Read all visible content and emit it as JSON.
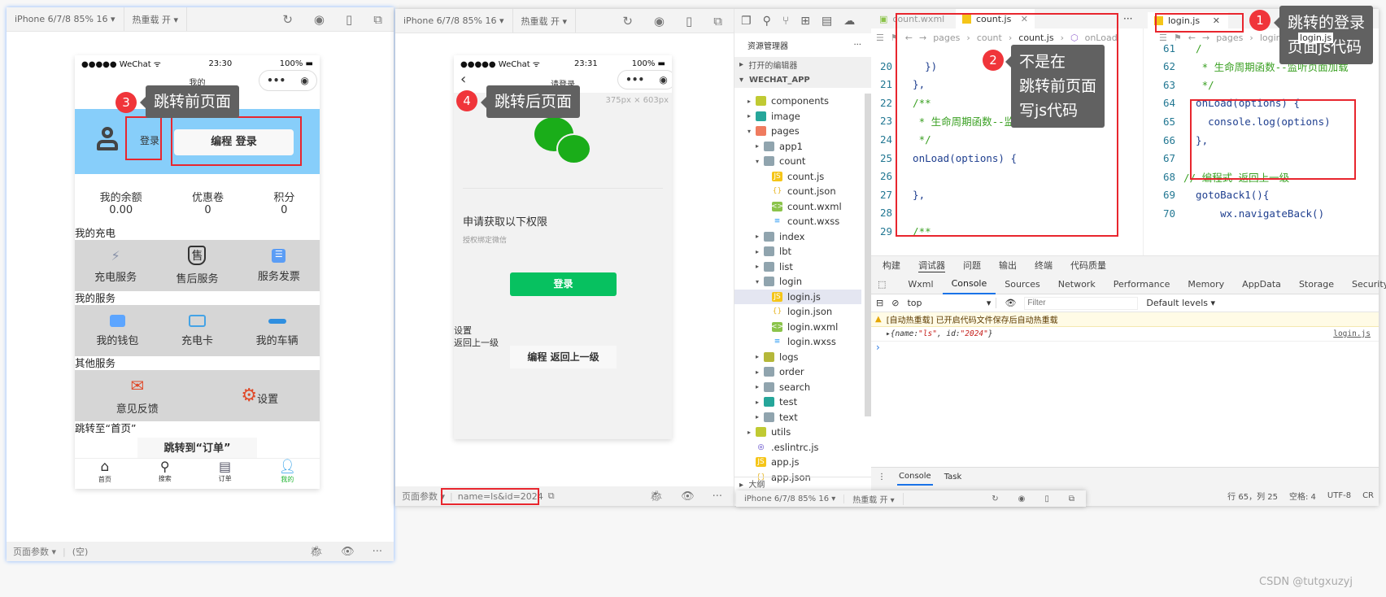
{
  "left_sim": {
    "device": "iPhone 6/7/8 85% 16 ▾",
    "hot_reload": "热重载 开 ▾",
    "status_carrier": "●●●●● WeChat ᯤ",
    "status_time": "23:30",
    "status_battery": "100%",
    "nav_title": "我的",
    "login_link": "登录",
    "login_button": "编程 登录",
    "stats": [
      {
        "label": "我的余额",
        "value": "0.00"
      },
      {
        "label": "优惠卷",
        "value": "0"
      },
      {
        "label": "积分",
        "value": "0"
      }
    ],
    "section_charge": "我的充电",
    "charge_items": [
      {
        "label": "充电服务",
        "icon": "plug-icon"
      },
      {
        "label": "售后服务",
        "icon": "shield-icon"
      },
      {
        "label": "服务发票",
        "icon": "invoice-icon"
      }
    ],
    "section_service": "我的服务",
    "service_items": [
      {
        "label": "我的钱包",
        "icon": "wallet-icon"
      },
      {
        "label": "充电卡",
        "icon": "card-icon"
      },
      {
        "label": "我的车辆",
        "icon": "car-icon"
      }
    ],
    "section_other": "其他服务",
    "other_items": [
      {
        "label": "意见反馈",
        "icon": "mail-icon"
      },
      {
        "label": "设置",
        "icon": "gear-icon"
      }
    ],
    "goto_home": "跳转至“首页”",
    "goto_order_button": "跳转到“订单”",
    "tabbar": [
      {
        "label": "首页",
        "icon": "home-icon"
      },
      {
        "label": "搜索",
        "icon": "search-icon"
      },
      {
        "label": "订单",
        "icon": "order-icon"
      },
      {
        "label": "我的",
        "icon": "user-icon",
        "active": true
      }
    ],
    "page_params_label": "页面参数 ▾",
    "page_params_value": "(空)"
  },
  "mid_sim": {
    "device": "iPhone 6/7/8 85% 16 ▾",
    "hot_reload": "热重载 开 ▾",
    "status_carrier": "●●●●● WeChat ᯤ",
    "status_time": "23:31",
    "status_battery": "100%",
    "nav_title": "请登录",
    "size_hint": "375px × 603px",
    "perm_title": "申请获取以下权限",
    "perm_desc": "授权绑定微信",
    "login_button": "登录",
    "settings_text": "设置",
    "back_text": "返回上一级",
    "back_button": "编程 返回上一级",
    "page_params_label": "页面参数 ▾",
    "page_params_value": "name=ls&id=2024"
  },
  "explorer": {
    "title": "资源管理器",
    "more": "···",
    "open_editors": "打开的编辑器",
    "root": "WECHAT_APP",
    "items": [
      {
        "label": "components",
        "depth": 1,
        "type": "folder-green",
        "tri": "▸"
      },
      {
        "label": "image",
        "depth": 1,
        "type": "folder-teal",
        "tri": "▸"
      },
      {
        "label": "pages",
        "depth": 1,
        "type": "folder-red",
        "tri": "▾"
      },
      {
        "label": "app1",
        "depth": 2,
        "type": "folder",
        "tri": "▸"
      },
      {
        "label": "count",
        "depth": 2,
        "type": "folder",
        "tri": "▾"
      },
      {
        "label": "count.js",
        "depth": 3,
        "type": "js",
        "tri": ""
      },
      {
        "label": "count.json",
        "depth": 3,
        "type": "json",
        "tri": ""
      },
      {
        "label": "count.wxml",
        "depth": 3,
        "type": "wxml",
        "tri": ""
      },
      {
        "label": "count.wxss",
        "depth": 3,
        "type": "wxss",
        "tri": ""
      },
      {
        "label": "index",
        "depth": 2,
        "type": "folder",
        "tri": "▸"
      },
      {
        "label": "lbt",
        "depth": 2,
        "type": "folder",
        "tri": "▸"
      },
      {
        "label": "list",
        "depth": 2,
        "type": "folder",
        "tri": "▸"
      },
      {
        "label": "login",
        "depth": 2,
        "type": "folder",
        "tri": "▾"
      },
      {
        "label": "login.js",
        "depth": 3,
        "type": "js",
        "tri": "",
        "selected": true
      },
      {
        "label": "login.json",
        "depth": 3,
        "type": "json",
        "tri": ""
      },
      {
        "label": "login.wxml",
        "depth": 3,
        "type": "wxml",
        "tri": ""
      },
      {
        "label": "login.wxss",
        "depth": 3,
        "type": "wxss",
        "tri": ""
      },
      {
        "label": "logs",
        "depth": 2,
        "type": "folder-olive",
        "tri": "▸"
      },
      {
        "label": "order",
        "depth": 2,
        "type": "folder",
        "tri": "▸"
      },
      {
        "label": "search",
        "depth": 2,
        "type": "folder",
        "tri": "▸"
      },
      {
        "label": "test",
        "depth": 2,
        "type": "folder-teal",
        "tri": "▸"
      },
      {
        "label": "text",
        "depth": 2,
        "type": "folder",
        "tri": "▸"
      },
      {
        "label": "utils",
        "depth": 1,
        "type": "folder-green",
        "tri": "▸"
      },
      {
        "label": ".eslintrc.js",
        "depth": 1,
        "type": "eslint",
        "tri": ""
      },
      {
        "label": "app.js",
        "depth": 1,
        "type": "js",
        "tri": ""
      },
      {
        "label": "app.json",
        "depth": 1,
        "type": "json",
        "tri": ""
      }
    ],
    "outline": "大纲"
  },
  "editor_left": {
    "tabs": [
      {
        "label": "count.wxml"
      },
      {
        "label": "count.js",
        "active": true
      }
    ],
    "breadcrumb": [
      "pages",
      "count",
      "count.js",
      "onLoad"
    ],
    "lines": [
      {
        "n": "20",
        "text": "    })",
        "kind": "code"
      },
      {
        "n": "21",
        "text": "  },",
        "kind": "code"
      },
      {
        "n": "22",
        "text": "  /**",
        "kind": "comment"
      },
      {
        "n": "23",
        "text": "   * 生命周期函数--监听页面加载",
        "kind": "comment"
      },
      {
        "n": "24",
        "text": "   */",
        "kind": "comment"
      },
      {
        "n": "25",
        "text": "  onLoad(options) {",
        "kind": "code"
      },
      {
        "n": "26",
        "text": "",
        "kind": "code"
      },
      {
        "n": "27",
        "text": "  },",
        "kind": "code"
      },
      {
        "n": "28",
        "text": "",
        "kind": "code"
      },
      {
        "n": "29",
        "text": "  /**",
        "kind": "comment"
      }
    ]
  },
  "editor_right": {
    "more": "···",
    "tabs": [
      {
        "label": "login.js",
        "active": true
      }
    ],
    "breadcrumb": [
      "pages",
      "login",
      "login.js"
    ],
    "lines": [
      {
        "n": "61",
        "text": "  /",
        "kind": "comment"
      },
      {
        "n": "62",
        "text": "   * 生命周期函数--监听页面加载",
        "kind": "comment"
      },
      {
        "n": "63",
        "text": "   */",
        "kind": "comment"
      },
      {
        "n": "64",
        "text": "  onLoad(options) {",
        "kind": "code"
      },
      {
        "n": "65",
        "text": "    console.log(options)",
        "kind": "code"
      },
      {
        "n": "66",
        "text": "  },",
        "kind": "code"
      },
      {
        "n": "67",
        "text": "",
        "kind": "code"
      },
      {
        "n": "68",
        "text": "// 编程式 返回上一级",
        "kind": "comment"
      },
      {
        "n": "69",
        "text": "  gotoBack1(){",
        "kind": "code"
      },
      {
        "n": "70",
        "text": "      wx.navigateBack()",
        "kind": "code"
      }
    ]
  },
  "panel": {
    "top_tabs": [
      "构建",
      "调试器",
      "问题",
      "输出",
      "终端",
      "代码质量"
    ],
    "devtools_tabs": [
      "Wxml",
      "Console",
      "Sources",
      "Network",
      "Performance",
      "Memory",
      "AppData",
      "Storage",
      "Security",
      "»"
    ],
    "warn_count": "⚠ 1",
    "context": "top",
    "filter_placeholder": "Filter",
    "levels": "Default levels ▾",
    "warning": "[自动热重载] 已开启代码文件保存后自动热重载",
    "log_prefix": "▸{name: ",
    "log_name": "\"ls\"",
    "log_mid": ", id: ",
    "log_id": "\"2024\"",
    "log_suffix": "}",
    "log_source": "login.js",
    "prompt": "›",
    "drawer_tabs": [
      "Console",
      "Task"
    ]
  },
  "statusbar": {
    "position": "行 65，列 25",
    "spaces": "空格: 4",
    "encoding": "UTF-8",
    "eol": "CR"
  },
  "third_win": {
    "device": "iPhone 6/7/8 85% 16 ▾",
    "hot_reload": "热重载 开 ▾"
  },
  "annotations": [
    {
      "num": "1",
      "text": "跳转的登录\n页面js代码"
    },
    {
      "num": "2",
      "text": "不是在\n跳转前页面\n写js代码"
    },
    {
      "num": "3",
      "text": "跳转前页面"
    },
    {
      "num": "4",
      "text": "跳转后页面"
    }
  ],
  "watermark": "CSDN @tutgxuzyj",
  "colors": {
    "annotation_red": "#e8262e",
    "wechat_green": "#07c160",
    "header_blue": "#87cefa",
    "active_tab_green": "#21b533"
  }
}
